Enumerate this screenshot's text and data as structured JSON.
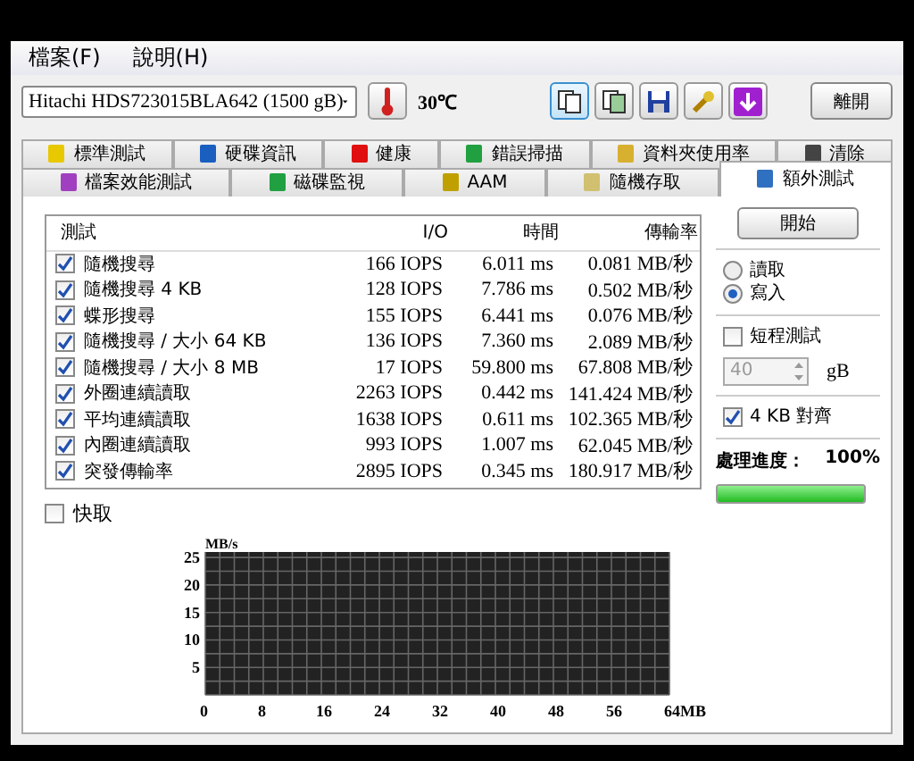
{
  "menu": [
    {
      "label": "檔案(F)"
    },
    {
      "label": "說明(H)"
    }
  ],
  "toolbar": {
    "drive": "Hitachi HDS723015BLA642 (1500 gB)",
    "temperature": "30℃",
    "exit_button": "離開"
  },
  "tab_rows": [
    {
      "tabs": [
        {
          "label": "標準測試",
          "selected": false
        },
        {
          "label": "硬碟資訊",
          "selected": false
        },
        {
          "label": "健康",
          "selected": false
        },
        {
          "label": "錯誤掃描",
          "selected": false
        },
        {
          "label": "資料夾使用率",
          "selected": false
        },
        {
          "label": "清除",
          "selected": false
        }
      ]
    },
    {
      "tabs": [
        {
          "label": "檔案效能測試",
          "selected": false
        },
        {
          "label": "磁碟監視",
          "selected": false
        },
        {
          "label": "AAM",
          "selected": false
        },
        {
          "label": "隨機存取",
          "selected": false
        },
        {
          "label": "額外測試",
          "selected": true
        }
      ]
    }
  ],
  "table": {
    "columns": [
      "測試",
      "I/O",
      "時間",
      "傳輸率"
    ],
    "rows": [
      {
        "name": "隨機搜尋",
        "checked": true,
        "io": "166 IOPS",
        "time": "6.011 ms",
        "rate": "0.081 MB/秒"
      },
      {
        "name": "隨機搜尋 4 KB",
        "checked": true,
        "io": "128 IOPS",
        "time": "7.786 ms",
        "rate": "0.502 MB/秒"
      },
      {
        "name": "蝶形搜尋",
        "checked": true,
        "io": "155 IOPS",
        "time": "6.441 ms",
        "rate": "0.076 MB/秒"
      },
      {
        "name": "隨機搜尋 / 大小 64 KB",
        "checked": true,
        "io": "136 IOPS",
        "time": "7.360 ms",
        "rate": "2.089 MB/秒"
      },
      {
        "name": "隨機搜尋 / 大小 8 MB",
        "checked": true,
        "io": "17 IOPS",
        "time": "59.800 ms",
        "rate": "67.808 MB/秒"
      },
      {
        "name": "外圈連續讀取",
        "checked": true,
        "io": "2263 IOPS",
        "time": "0.442 ms",
        "rate": "141.424 MB/秒"
      },
      {
        "name": "平均連續讀取",
        "checked": true,
        "io": "1638 IOPS",
        "time": "0.611 ms",
        "rate": "102.365 MB/秒"
      },
      {
        "name": "內圈連續讀取",
        "checked": true,
        "io": "993 IOPS",
        "time": "1.007 ms",
        "rate": "62.045 MB/秒"
      },
      {
        "name": "突發傳輸率",
        "checked": true,
        "io": "2895 IOPS",
        "time": "0.345 ms",
        "rate": "180.917 MB/秒"
      }
    ]
  },
  "cache": {
    "label": "快取",
    "checked": false
  },
  "side": {
    "start_button": "開始",
    "modes": [
      {
        "label": "讀取",
        "selected": false
      },
      {
        "label": "寫入",
        "selected": true
      }
    ],
    "short_test": {
      "label": "短程測試",
      "checked": false
    },
    "size": {
      "value": "40",
      "unit": "gB",
      "disabled": true
    },
    "align": {
      "label": "4 KB 對齊",
      "checked": true
    },
    "progress": {
      "label": "處理進度：",
      "value": "100%",
      "level": 1
    }
  },
  "chart": {
    "chart_data": {
      "type": "line",
      "grid": true,
      "ylabel": "MB/s",
      "xlim": [
        0,
        64
      ],
      "ylim": [
        0,
        26
      ],
      "xticks": [
        0,
        8,
        16,
        24,
        32,
        40,
        48,
        56,
        {
          "value": 64,
          "label": "64MB"
        }
      ],
      "yticks": [
        5,
        10,
        15,
        20,
        25
      ]
    }
  }
}
